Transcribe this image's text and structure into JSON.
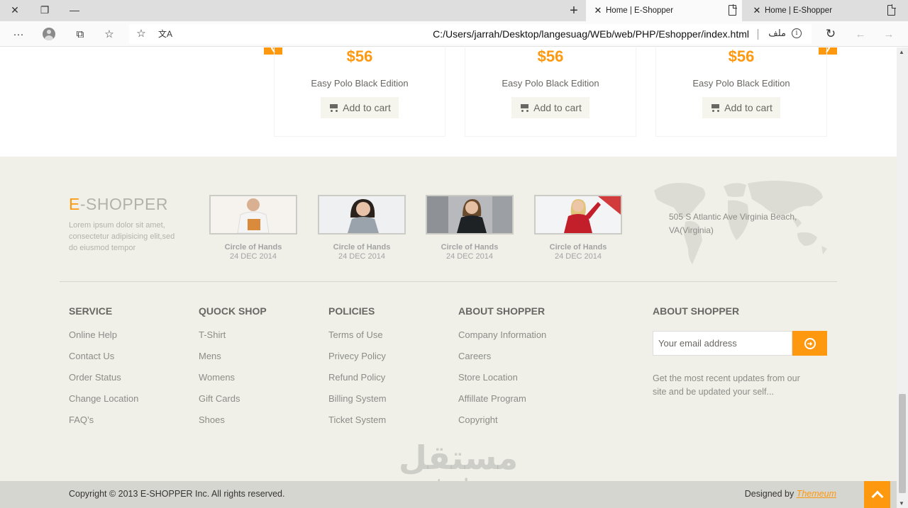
{
  "browser": {
    "tabs": [
      {
        "title": "Home | E-Shopper",
        "active": true
      },
      {
        "title": "Home | E-Shopper",
        "active": false
      }
    ],
    "url": "C:/Users/jarrah/Desktop/langesuag/WEb/web/PHP/Eshopper/index.html",
    "url_label": "ملف",
    "info_glyph": "i"
  },
  "products": [
    {
      "price": "$56",
      "name": "Easy Polo Black Edition",
      "cart_label": "Add to cart"
    },
    {
      "price": "$56",
      "name": "Easy Polo Black Edition",
      "cart_label": "Add to cart"
    },
    {
      "price": "$56",
      "name": "Easy Polo Black Edition",
      "cart_label": "Add to cart"
    }
  ],
  "footer": {
    "brand_first": "E",
    "brand_rest": "-SHOPPER",
    "brand_text": "Lorem ipsum dolor sit amet, consectetur adipisicing elit,sed do eiusmod tempor",
    "videos": [
      {
        "caption": "Circle of Hands",
        "date": "24 DEC 2014"
      },
      {
        "caption": "Circle of Hands",
        "date": "24 DEC 2014"
      },
      {
        "caption": "Circle of Hands",
        "date": "24 DEC 2014"
      },
      {
        "caption": "Circle of Hands",
        "date": "24 DEC 2014"
      }
    ],
    "address": "505 S Atlantic Ave Virginia Beach, VA(Virginia)",
    "columns": [
      {
        "heading": "SERVICE",
        "links": [
          "Online Help",
          "Contact Us",
          "Order Status",
          "Change Location",
          "FAQ’s"
        ]
      },
      {
        "heading": "QUOCK SHOP",
        "links": [
          "T-Shirt",
          "Mens",
          "Womens",
          "Gift Cards",
          "Shoes"
        ]
      },
      {
        "heading": "POLICIES",
        "links": [
          "Terms of Use",
          "Privecy Policy",
          "Refund Policy",
          "Billing System",
          "Ticket System"
        ]
      },
      {
        "heading": "ABOUT SHOPPER",
        "links": [
          "Company Information",
          "Careers",
          "Store Location",
          "Affillate Program",
          "Copyright"
        ]
      }
    ],
    "newsletter": {
      "heading": "ABOUT SHOPPER",
      "placeholder": "Your email address",
      "text": "Get the most recent updates from our site and be updated your self..."
    },
    "copyright": "Copyright © 2013 E-SHOPPER Inc. All rights reserved.",
    "designed_by": "Designed by ",
    "designer": "Themeum"
  },
  "watermark": {
    "arabic": "مستقل",
    "latin": "mostaql.com"
  },
  "colors": {
    "accent": "#FE980F",
    "footer_bg": "#F0F0E9",
    "footer_bottom": "#D6D6D0",
    "text": "#696763"
  }
}
